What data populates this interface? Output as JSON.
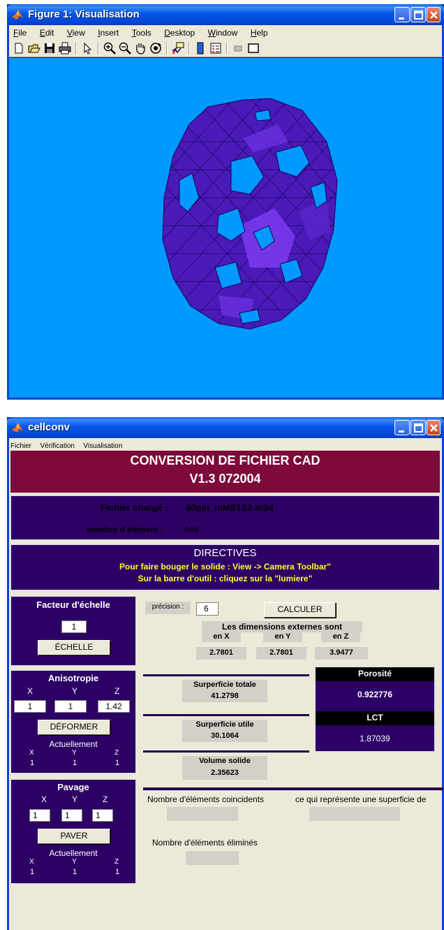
{
  "figure_window": {
    "title": "Figure 1: Visualisation",
    "menu": [
      "File",
      "Edit",
      "View",
      "Insert",
      "Tools",
      "Desktop",
      "Window",
      "Help"
    ],
    "toolbar_icons": [
      "new-file-icon",
      "open-file-icon",
      "save-icon",
      "print-icon",
      "arrow-pointer-icon",
      "zoom-in-icon",
      "zoom-out-icon",
      "pan-hand-icon",
      "rotate-3d-icon",
      "data-cursor-icon",
      "colorbar-icon",
      "legend-icon",
      "hide-plot-tools-icon",
      "show-plot-tools-icon"
    ],
    "canvas_color": "#0099ff",
    "solid_color": "#4a1ab8"
  },
  "cellconv_window": {
    "title": "cellconv",
    "menu": [
      "Fichier",
      "Vérification",
      "Visualisation"
    ],
    "header": {
      "title": "CONVERSION DE FICHIER CAD",
      "version": "V1.3 072004"
    },
    "file_info": {
      "loaded_label": "Fichier chargé :",
      "loaded_value": "40ppi_mMS1S2.m3d",
      "elements_label": "nombre d'élément :",
      "elements_value": "648"
    },
    "directives": {
      "title": "DIRECTIVES",
      "line1": "Pour faire bouger le solide : View -> Camera Toolbar\"",
      "line2": "Sur la barre d'outil : cliquez sur la \"lumiere\""
    },
    "scale": {
      "title": "Facteur d'échelle",
      "value": "1",
      "button": "ÉCHELLE"
    },
    "anisotropy": {
      "title": "Anisotropie",
      "axes": [
        "X",
        "Y",
        "Z"
      ],
      "values": [
        "1",
        "1",
        "1.42"
      ],
      "button": "DÉFORMER",
      "current_label": "Actuellement",
      "current_axes": [
        "X",
        "Y",
        "Z"
      ],
      "current_values": [
        "1",
        "1",
        "1"
      ]
    },
    "tiling": {
      "title": "Pavage",
      "axes": [
        "X",
        "Y",
        "Z"
      ],
      "values": [
        "1",
        "1",
        "1"
      ],
      "button": "PAVER",
      "current_label": "Actuellement",
      "current_axes": [
        "X",
        "Y",
        "Z"
      ],
      "current_values": [
        "1",
        "1",
        "1"
      ]
    },
    "precision": {
      "label": "précision :",
      "value": "6"
    },
    "calculate_button": "CALCULER",
    "dimensions": {
      "title": "Les dimensions externes sont",
      "headers": [
        "en X",
        "en Y",
        "en Z"
      ],
      "values": [
        "2.7801",
        "2.7801",
        "3.9477"
      ]
    },
    "total_surface": {
      "label": "Surperficie totale",
      "value": "41.2798"
    },
    "useful_surface": {
      "label": "Surperficie utile",
      "value": "30.1064"
    },
    "solid_volume": {
      "label": "Volume solide",
      "value": "2.35623"
    },
    "porosity": {
      "label": "Porosité",
      "value": "0.922776"
    },
    "lct": {
      "label": "LCT",
      "value": "1.87039"
    },
    "coincident": {
      "label": "Nombre d'éléments coincidents",
      "value": ""
    },
    "represents": {
      "label": "ce qui représente une superficie de",
      "value": ""
    },
    "eliminated": {
      "label": "Nombre d'éléments éliminés",
      "value": ""
    }
  }
}
